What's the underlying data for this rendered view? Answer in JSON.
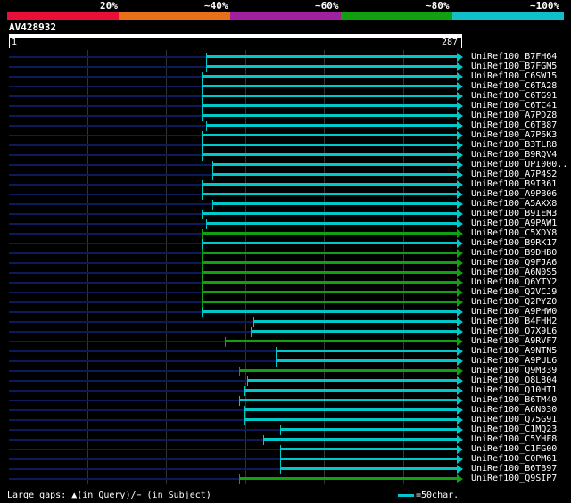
{
  "legend": {
    "labels": [
      "20%",
      "~40%",
      "~60%",
      "~80%",
      "~100%"
    ],
    "colors": [
      "#e8103a",
      "#e8701a",
      "#a020a0",
      "#10a010",
      "#10c0c8"
    ]
  },
  "query": {
    "id": "AV428932",
    "start": "1",
    "end": "287",
    "length": 287
  },
  "hits": [
    {
      "label": "UniRef100_B7FH64",
      "start": 126,
      "end": 287,
      "color": "#00c8c8"
    },
    {
      "label": "UniRef100_B7FGM5",
      "start": 126,
      "end": 287,
      "color": "#00c8c8"
    },
    {
      "label": "UniRef100_C6SW15",
      "start": 123,
      "end": 287,
      "color": "#00c8c8"
    },
    {
      "label": "UniRef100_C6TA28",
      "start": 123,
      "end": 287,
      "color": "#00c8c8"
    },
    {
      "label": "UniRef100_C6TG91",
      "start": 123,
      "end": 287,
      "color": "#00c8c8"
    },
    {
      "label": "UniRef100_C6TC41",
      "start": 123,
      "end": 287,
      "color": "#00c8c8"
    },
    {
      "label": "UniRef100_A7PDZ8",
      "start": 123,
      "end": 287,
      "color": "#00c8c8"
    },
    {
      "label": "UniRef100_C6TB87",
      "start": 126,
      "end": 287,
      "color": "#00c8c8"
    },
    {
      "label": "UniRef100_A7P6K3",
      "start": 123,
      "end": 287,
      "color": "#00c8c8"
    },
    {
      "label": "UniRef100_B3TLR8",
      "start": 123,
      "end": 287,
      "color": "#00c8c8"
    },
    {
      "label": "UniRef100_B9RQV4",
      "start": 123,
      "end": 287,
      "color": "#00c8c8"
    },
    {
      "label": "UniRef100_UPI000..",
      "start": 130,
      "end": 287,
      "color": "#00c8c8"
    },
    {
      "label": "UniRef100_A7P4S2",
      "start": 130,
      "end": 287,
      "color": "#00c8c8"
    },
    {
      "label": "UniRef100_B9I361",
      "start": 123,
      "end": 287,
      "color": "#00c8c8"
    },
    {
      "label": "UniRef100_A9PB06",
      "start": 123,
      "end": 287,
      "color": "#00c8c8"
    },
    {
      "label": "UniRef100_A5AXX8",
      "start": 130,
      "end": 287,
      "color": "#00c8c8"
    },
    {
      "label": "UniRef100_B9IEM3",
      "start": 123,
      "end": 287,
      "color": "#00c8c8"
    },
    {
      "label": "UniRef100_A9PAW1",
      "start": 126,
      "end": 287,
      "color": "#00c8c8"
    },
    {
      "label": "UniRef100_C5XDY8",
      "start": 123,
      "end": 287,
      "color": "#10a010"
    },
    {
      "label": "UniRef100_B9RK17",
      "start": 123,
      "end": 287,
      "color": "#00c8c8"
    },
    {
      "label": "UniRef100_B9DHB0",
      "start": 123,
      "end": 287,
      "color": "#10a010"
    },
    {
      "label": "UniRef100_Q9FJA6",
      "start": 123,
      "end": 287,
      "color": "#10a010"
    },
    {
      "label": "UniRef100_A6N0S5",
      "start": 123,
      "end": 287,
      "color": "#10a010"
    },
    {
      "label": "UniRef100_Q6YTY2",
      "start": 123,
      "end": 287,
      "color": "#10a010"
    },
    {
      "label": "UniRef100_Q2VCJ9",
      "start": 123,
      "end": 287,
      "color": "#10a010"
    },
    {
      "label": "UniRef100_Q2PYZ0",
      "start": 123,
      "end": 287,
      "color": "#10a010"
    },
    {
      "label": "UniRef100_A9PHW0",
      "start": 123,
      "end": 287,
      "color": "#00c8c8"
    },
    {
      "label": "UniRef100_B4FHH2",
      "start": 156,
      "end": 287,
      "color": "#00c8c8"
    },
    {
      "label": "UniRef100_Q7X9L6",
      "start": 154,
      "end": 287,
      "color": "#00c8c8"
    },
    {
      "label": "UniRef100_A9RVF7",
      "start": 138,
      "end": 287,
      "color": "#10a010"
    },
    {
      "label": "UniRef100_A9NTN5",
      "start": 170,
      "end": 287,
      "color": "#00c8c8"
    },
    {
      "label": "UniRef100_A9PUL6",
      "start": 170,
      "end": 287,
      "color": "#00c8c8"
    },
    {
      "label": "UniRef100_Q9M339",
      "start": 147,
      "end": 287,
      "color": "#10a010"
    },
    {
      "label": "UniRef100_Q8L804",
      "start": 152,
      "end": 287,
      "color": "#00c8c8"
    },
    {
      "label": "UniRef100_Q10HT1",
      "start": 150,
      "end": 287,
      "color": "#00c8c8"
    },
    {
      "label": "UniRef100_B6TM40",
      "start": 147,
      "end": 287,
      "color": "#00c8c8"
    },
    {
      "label": "UniRef100_A6N030",
      "start": 150,
      "end": 287,
      "color": "#00c8c8"
    },
    {
      "label": "UniRef100_Q75G91",
      "start": 150,
      "end": 287,
      "color": "#00c8c8"
    },
    {
      "label": "UniRef100_C1MQ23",
      "start": 173,
      "end": 287,
      "color": "#00c8c8"
    },
    {
      "label": "UniRef100_C5YHF8",
      "start": 162,
      "end": 287,
      "color": "#00c8c8"
    },
    {
      "label": "UniRef100_C1FG00",
      "start": 173,
      "end": 287,
      "color": "#00c8c8"
    },
    {
      "label": "UniRef100_C0PM61",
      "start": 173,
      "end": 287,
      "color": "#00c8c8"
    },
    {
      "label": "UniRef100_B6TB97",
      "start": 173,
      "end": 287,
      "color": "#00c8c8"
    },
    {
      "label": "UniRef100_Q9SIP7",
      "start": 147,
      "end": 287,
      "color": "#10a010"
    }
  ],
  "footer": {
    "gaps_text": "Large gaps: ▲(in Query)/− (in Subject)",
    "scale_text": "=50char."
  }
}
